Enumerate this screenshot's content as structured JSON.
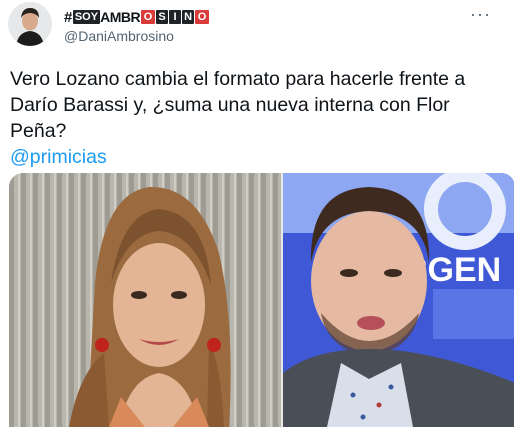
{
  "user": {
    "display_name_prefix": "#",
    "display_name_tiles": [
      {
        "text": "SOY",
        "style": "dark"
      },
      {
        "text": "AMBR",
        "style": "plain"
      },
      {
        "text": "O",
        "style": "red"
      },
      {
        "text": "S",
        "style": "dark"
      },
      {
        "text": "I",
        "style": "dark"
      },
      {
        "text": "N",
        "style": "dark"
      },
      {
        "text": "O",
        "style": "red"
      }
    ],
    "handle": "@DaniAmbrosino"
  },
  "more_icon": "···",
  "tweet": {
    "line1": "Vero Lozano cambia el formato para hacerle frente a",
    "line2": "Darío Barassi y, ¿suma una nueva interna con Flor",
    "line3": "Peña?",
    "mention": "@primicias"
  },
  "media": {
    "right_bg_text": "RGEN"
  },
  "colors": {
    "link": "#1d9bf0",
    "secondary_text": "#536471",
    "primary_text": "#0f1419"
  }
}
